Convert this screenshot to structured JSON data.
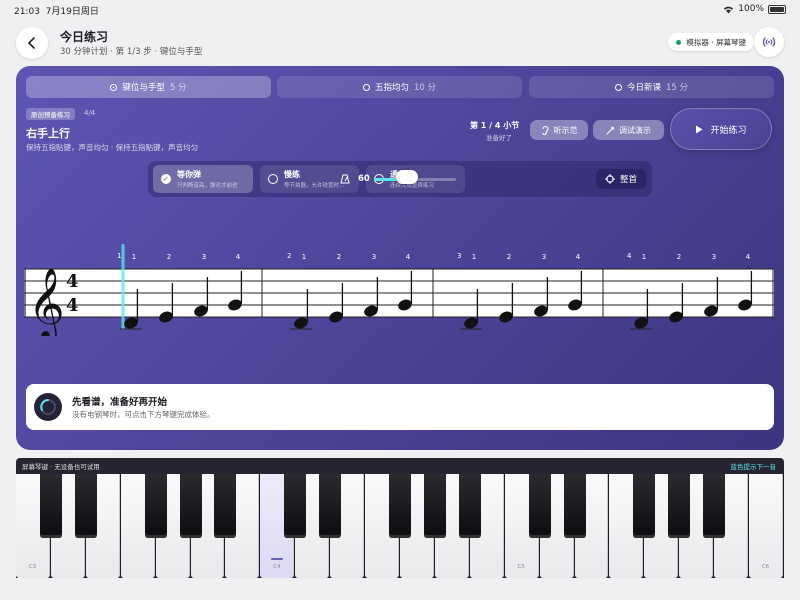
{
  "status_bar": {
    "time": "21:03",
    "date": "7月19日周日",
    "battery": "100%"
  },
  "header": {
    "title": "今日练习",
    "subtitle": "30 分钟计划 · 第 1/3 步 · 键位与手型",
    "mode_badge": "模拟器 · 屏幕琴键",
    "icons": {
      "back": "chevron-left-icon",
      "signal": "broadcast-icon"
    }
  },
  "tabs": [
    {
      "label": "键位与手型",
      "mins": "5 分",
      "active": true
    },
    {
      "label": "五指均匀",
      "mins": "10 分",
      "active": false
    },
    {
      "label": "今日新课",
      "mins": "15 分",
      "active": false
    }
  ],
  "lesson": {
    "chip": "原创预备练习",
    "counter": "4/4",
    "title": "右手上行",
    "description": "保持五指贴键，声音均匀 · 保持五指贴键，声音均匀"
  },
  "progress": {
    "label": "第 1 / 4 小节",
    "sub": "准备好了"
  },
  "actions": {
    "listen": "听示范",
    "debug": "调试演示",
    "start": "开始练习"
  },
  "practice_modes": [
    {
      "name": "等你弹",
      "desc": "只判断音高，弹对才前进",
      "active": true
    },
    {
      "name": "慢练",
      "desc": "等节拍器，允许较宽时...",
      "active": false
    },
    {
      "name": "通关",
      "desc": "连续完成整首练习",
      "active": false
    }
  ],
  "tempo": {
    "value": "60",
    "level": 0.4
  },
  "tune_label": "整首",
  "score": {
    "time_signature": [
      "4",
      "4"
    ],
    "measure_numbers": [
      "1",
      "2",
      "3",
      "4"
    ],
    "fingering": [
      "1",
      "2",
      "3",
      "4",
      "1",
      "2",
      "3",
      "4",
      "1",
      "2",
      "3",
      "4",
      "1",
      "2",
      "3",
      "4"
    ]
  },
  "tip": {
    "title": "先看谱，准备好再开始",
    "subtitle": "没有电钢琴时，可点击下方琴键完成体验。"
  },
  "keyboard": {
    "left_label": "屏幕琴键 · 无设备也可试用",
    "right_label": "蓝色提示下一音",
    "key_labels": [
      "C3",
      "C4",
      "C5",
      "C6"
    ],
    "highlight_note": "C4"
  },
  "colors": {
    "accent": "#5e55b4",
    "cyan": "#5ce6ea",
    "panel_dark": "#3c3581"
  }
}
